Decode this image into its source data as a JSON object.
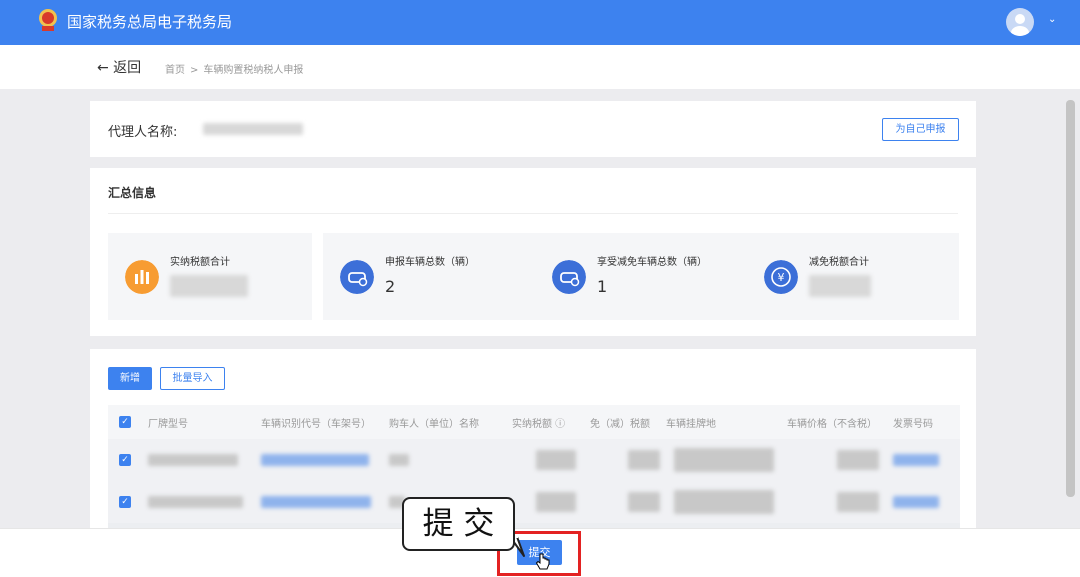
{
  "header": {
    "title": "国家税务总局电子税务局",
    "caret": "⌄"
  },
  "nav": {
    "back_label": "← 返回",
    "breadcrumb": [
      "首页",
      "车辆购置税纳税人申报"
    ],
    "breadcrumb_sep": ">"
  },
  "agent": {
    "label": "代理人名称:",
    "self_button": "为自己申报"
  },
  "summary": {
    "title": "汇总信息",
    "stats": [
      {
        "label": "实纳税额合计",
        "value": "",
        "icon": "chart-bars-icon",
        "color": "#f79c32"
      },
      {
        "label": "申报车辆总数（辆）",
        "value": "2",
        "icon": "car-icon",
        "color": "#3c6fd8"
      },
      {
        "label": "享受减免车辆总数（辆）",
        "value": "1",
        "icon": "car-icon",
        "color": "#3c6fd8"
      },
      {
        "label": "减免税额合计",
        "value": "",
        "icon": "yen-icon",
        "color": "#3c6fd8"
      }
    ]
  },
  "table": {
    "add_button": "新增",
    "import_button": "批量导入",
    "columns": [
      "厂牌型号",
      "车辆识别代号（车架号）",
      "购车人（单位）名称",
      "实纳税额 ⓘ",
      "免（减）税额",
      "车辆挂牌地",
      "车辆价格（不含税）",
      "发票号码"
    ],
    "checkmark": "✓"
  },
  "footer": {
    "submit_button": "提交"
  },
  "callout": {
    "text": "提 交"
  }
}
